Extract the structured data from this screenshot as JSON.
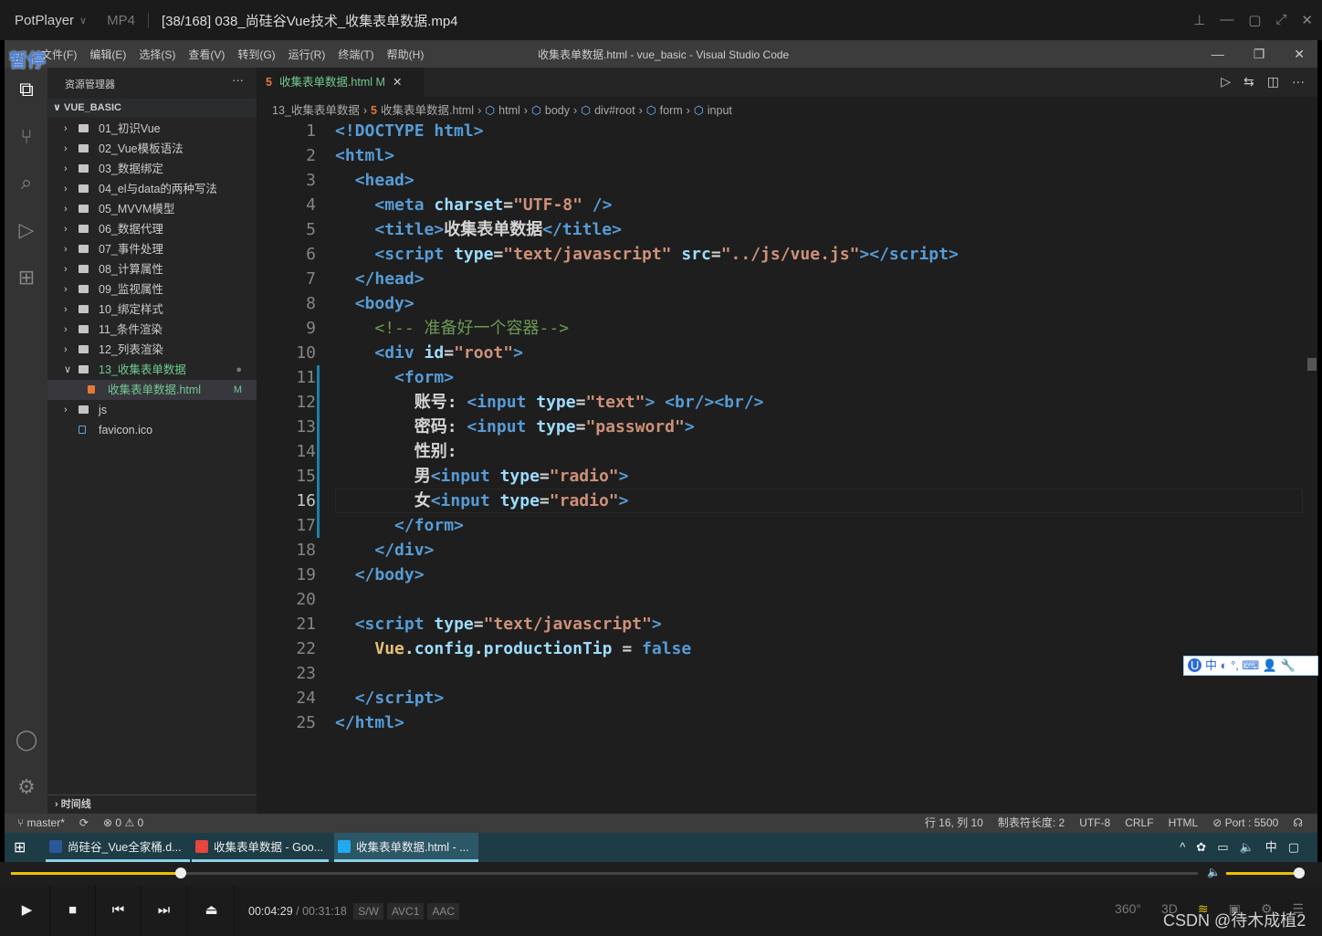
{
  "player": {
    "brand": "PotPlayer",
    "format": "MP4",
    "file": "[38/168] 038_尚硅谷Vue技术_收集表单数据.mp4",
    "paused_label": "暂停"
  },
  "vscode": {
    "menu": [
      "文件(F)",
      "编辑(E)",
      "选择(S)",
      "查看(V)",
      "转到(G)",
      "运行(R)",
      "终端(T)",
      "帮助(H)"
    ],
    "window_title": "收集表单数据.html - vue_basic - Visual Studio Code",
    "explorer": {
      "title": "资源管理器",
      "more": "···",
      "root": "VUE_BASIC",
      "timeline": "时间线",
      "items": [
        {
          "label": "01_初识Vue",
          "type": "folder"
        },
        {
          "label": "02_Vue模板语法",
          "type": "folder"
        },
        {
          "label": "03_数据绑定",
          "type": "folder"
        },
        {
          "label": "04_el与data的两种写法",
          "type": "folder"
        },
        {
          "label": "05_MVVM模型",
          "type": "folder"
        },
        {
          "label": "06_数据代理",
          "type": "folder"
        },
        {
          "label": "07_事件处理",
          "type": "folder"
        },
        {
          "label": "08_计算属性",
          "type": "folder"
        },
        {
          "label": "09_监视属性",
          "type": "folder"
        },
        {
          "label": "10_绑定样式",
          "type": "folder"
        },
        {
          "label": "11_条件渲染",
          "type": "folder"
        },
        {
          "label": "12_列表渲染",
          "type": "folder"
        },
        {
          "label": "13_收集表单数据",
          "type": "folder-open",
          "badge": "●"
        },
        {
          "label": "收集表单数据.html",
          "type": "html",
          "badge": "M",
          "selected": true
        },
        {
          "label": "js",
          "type": "folder"
        },
        {
          "label": "favicon.ico",
          "type": "file"
        }
      ]
    },
    "tab": {
      "label": "收集表单数据.html",
      "status": "M",
      "close": "✕"
    },
    "breadcrumbs": [
      "13_收集表单数据",
      "收集表单数据.html",
      "html",
      "body",
      "div#root",
      "form",
      "input"
    ],
    "current_line": 16,
    "code": [
      [
        [
          "tag",
          "<!DOCTYPE html>"
        ]
      ],
      [
        [
          "tag",
          "<html>"
        ]
      ],
      [
        [
          "txt",
          "  "
        ],
        [
          "tag",
          "<head>"
        ]
      ],
      [
        [
          "txt",
          "    "
        ],
        [
          "tag",
          "<meta "
        ],
        [
          "attr",
          "charset"
        ],
        [
          "txt",
          "="
        ],
        [
          "str",
          "\"UTF-8\""
        ],
        [
          "tag",
          " />"
        ]
      ],
      [
        [
          "txt",
          "    "
        ],
        [
          "tag",
          "<title>"
        ],
        [
          "txt",
          "收集表单数据"
        ],
        [
          "tag",
          "</title>"
        ]
      ],
      [
        [
          "txt",
          "    "
        ],
        [
          "tag",
          "<script "
        ],
        [
          "attr",
          "type"
        ],
        [
          "txt",
          "="
        ],
        [
          "str",
          "\"text/javascript\""
        ],
        [
          "attr",
          " src"
        ],
        [
          "txt",
          "="
        ],
        [
          "str",
          "\"../js/vue.js\""
        ],
        [
          "tag",
          "></script>"
        ]
      ],
      [
        [
          "txt",
          "  "
        ],
        [
          "tag",
          "</head>"
        ]
      ],
      [
        [
          "txt",
          "  "
        ],
        [
          "tag",
          "<body>"
        ]
      ],
      [
        [
          "txt",
          "    "
        ],
        [
          "com",
          "<!-- 准备好一个容器-->"
        ]
      ],
      [
        [
          "txt",
          "    "
        ],
        [
          "tag",
          "<div "
        ],
        [
          "attr",
          "id"
        ],
        [
          "txt",
          "="
        ],
        [
          "str",
          "\"root\""
        ],
        [
          "tag",
          ">"
        ]
      ],
      [
        [
          "txt",
          "      "
        ],
        [
          "tag",
          "<form>"
        ]
      ],
      [
        [
          "txt",
          "        账号: "
        ],
        [
          "tag",
          "<input "
        ],
        [
          "attr",
          "type"
        ],
        [
          "txt",
          "="
        ],
        [
          "str",
          "\"text\""
        ],
        [
          "tag",
          "> <br/><br/>"
        ]
      ],
      [
        [
          "txt",
          "        密码: "
        ],
        [
          "tag",
          "<input "
        ],
        [
          "attr",
          "type"
        ],
        [
          "txt",
          "="
        ],
        [
          "str",
          "\"password\""
        ],
        [
          "tag",
          ">"
        ]
      ],
      [
        [
          "txt",
          "        性别:"
        ]
      ],
      [
        [
          "txt",
          "        男"
        ],
        [
          "tag",
          "<input "
        ],
        [
          "attr",
          "type"
        ],
        [
          "txt",
          "="
        ],
        [
          "str",
          "\"radio\""
        ],
        [
          "tag",
          ">"
        ]
      ],
      [
        [
          "txt",
          "        女"
        ],
        [
          "tag",
          "<input "
        ],
        [
          "attr",
          "type"
        ],
        [
          "txt",
          "="
        ],
        [
          "str",
          "\"radio\""
        ],
        [
          "tag",
          ">"
        ]
      ],
      [
        [
          "txt",
          "      "
        ],
        [
          "tag",
          "</form>"
        ]
      ],
      [
        [
          "txt",
          "    "
        ],
        [
          "tag",
          "</div>"
        ]
      ],
      [
        [
          "txt",
          "  "
        ],
        [
          "tag",
          "</body>"
        ]
      ],
      [],
      [
        [
          "txt",
          "  "
        ],
        [
          "tag",
          "<script "
        ],
        [
          "attr",
          "type"
        ],
        [
          "txt",
          "="
        ],
        [
          "str",
          "\"text/javascript\""
        ],
        [
          "tag",
          ">"
        ]
      ],
      [
        [
          "txt",
          "    "
        ],
        [
          "el",
          "Vue"
        ],
        [
          "txt",
          "."
        ],
        [
          "attr",
          "config"
        ],
        [
          "txt",
          "."
        ],
        [
          "attr",
          "productionTip"
        ],
        [
          "txt",
          " = "
        ],
        [
          "tag",
          "false"
        ]
      ],
      [],
      [
        [
          "txt",
          "  "
        ],
        [
          "tag",
          "</script>"
        ]
      ],
      [
        [
          "tag",
          "</html>"
        ]
      ]
    ],
    "status": {
      "branch": "master*",
      "sync": "⟳",
      "problems": "⊗ 0 ⚠ 0",
      "position": "行 16, 列 10",
      "tab_size": "制表符长度: 2",
      "encoding": "UTF-8",
      "eol": "CRLF",
      "language": "HTML",
      "port": "⊘ Port : 5500",
      "feedback": "☊"
    }
  },
  "ime": "中 ◐ °, ⌨ 👤 🔧",
  "taskbar": {
    "items": [
      {
        "label": "尚硅谷_Vue全家桶.d...",
        "color": "#2b579a"
      },
      {
        "label": "收集表单数据 - Goo...",
        "color": "#e8453c"
      },
      {
        "label": "收集表单数据.html - ...",
        "color": "#23a9f2",
        "active": true
      }
    ],
    "tray": [
      "^",
      "✿",
      "▭",
      "🔈",
      "中",
      "▢"
    ]
  },
  "playback": {
    "current": "00:04:29",
    "total": "00:31:18",
    "progress": 0.143,
    "volume": 1.0,
    "chips": [
      "S/W",
      "AVC1",
      "AAC"
    ],
    "right": [
      "360°",
      "3D",
      "≋",
      "▣",
      "⚙",
      "☰"
    ]
  },
  "watermark": "CSDN @待木成植2"
}
